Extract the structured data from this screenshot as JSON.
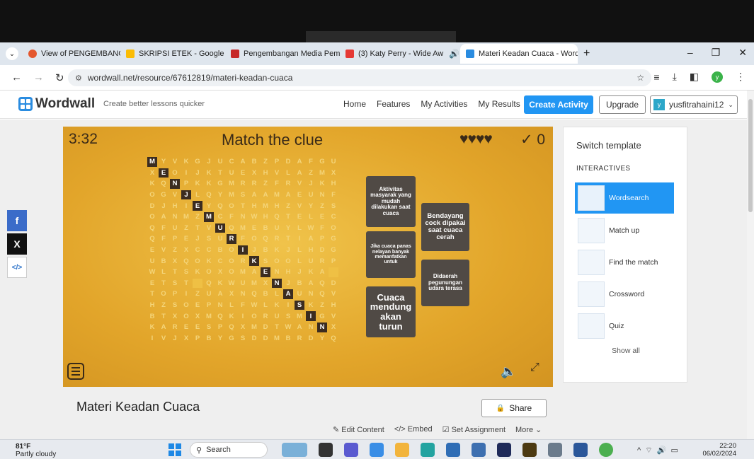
{
  "browser": {
    "tabs": [
      {
        "label": "View of PENGEMBANGAN M",
        "color": "#e4572e"
      },
      {
        "label": "SKRIPSI ETEK - Google Drive",
        "color": "#fbbc05"
      },
      {
        "label": "Pengembangan Media Pem",
        "color": "#c62828"
      },
      {
        "label": "(3) Katy Perry - Wide Aw",
        "color": "#e53935"
      },
      {
        "label": "Materi Keadan Cuaca - Word",
        "color": "#2a8ce0"
      }
    ],
    "url": "wordwall.net/resource/67612819/materi-keadan-cuaca",
    "profile_initial": "y"
  },
  "header": {
    "brand": "Wordwall",
    "tagline": "Create better lessons quicker",
    "menu": [
      "Home",
      "Features",
      "My Activities",
      "My Results"
    ],
    "create_label": "Create Activity",
    "upgrade_label": "Upgrade",
    "user_initial": "y",
    "username": "yusfitrahaini12"
  },
  "game": {
    "timer": "3:32",
    "title": "Match the clue",
    "lives": "♥♥♥♥",
    "score": "✓ 0",
    "grid_rows": [
      "MYVKGJUCABZPDAFGU",
      "XEOIJKTUEXHVLAZMX",
      "KQNPKKGMRRZFRVJKH",
      "OGVJLQYMSAAMAEUNF",
      "DJHIEYQOTHMHZVYZS",
      "OANMZMCFNWHQTELEC",
      "QFUZTVUQMEBUYLWFO",
      "QFPEJSURFOQRTIAPG",
      "EVZXCCBOIJBKJLHDG",
      "UBXQOKCORKSOOLURP",
      "WLTSKOXOMAENHJKA",
      "ETST QKWUMXNJBAQD",
      "TOPIZUAXNQBLAUNQV",
      "HZSOEPNLFWLKISKZH",
      "BTXOXMQKIORUSMIGV",
      "KAREESPQXMDTWANNX",
      "IVJXPBYGSDDMBRDYQ"
    ],
    "clues": [
      "Aktivitas masyarak yang mudah dilakukan saat cuaca",
      "Bendayang cock dipakai saat cuaca cerah",
      "Jika cuaca panas nelayan banyak memanfatkan untuk",
      "Didaerah pegunungan udara terasa",
      "Cuaca mendung akan turun"
    ]
  },
  "templates": {
    "title": "Switch template",
    "section": "INTERACTIVES",
    "items": [
      "Wordsearch",
      "Match up",
      "Find the match",
      "Crossword",
      "Quiz"
    ],
    "show_all": "Show all"
  },
  "activity": {
    "title": "Materi Keadan Cuaca",
    "share_label": "Share",
    "actions": [
      "Edit Content",
      "Embed",
      "Set Assignment",
      "More"
    ]
  },
  "taskbar": {
    "temp": "81°F",
    "weather": "Partly cloudy",
    "search": "Search",
    "time": "22:20",
    "date": "06/02/2024"
  }
}
